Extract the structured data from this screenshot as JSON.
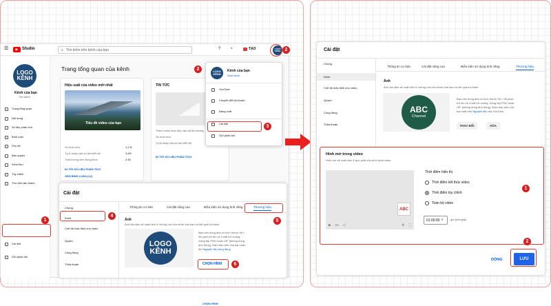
{
  "left": {
    "app": {
      "logo": "Studio",
      "search_placeholder": "Tìm kiếm trên kênh của bạn",
      "create_label": "TẠO"
    },
    "channel": {
      "logo_line1": "LOGO",
      "logo_line2": "KÊNH",
      "name": "Kênh của bạn",
      "handle": "Tên kênh"
    },
    "sidebar": [
      {
        "label": "Trang tổng quan",
        "icon": "dashboard-icon"
      },
      {
        "label": "Nội dung",
        "icon": "content-icon"
      },
      {
        "label": "Số liệu phân tích",
        "icon": "analytics-icon"
      },
      {
        "label": "Bình luận",
        "icon": "comments-icon"
      },
      {
        "label": "Phụ đề",
        "icon": "subtitles-icon"
      },
      {
        "label": "Bản quyền",
        "icon": "copyright-icon"
      },
      {
        "label": "Kiếm tiền",
        "icon": "monetization-icon"
      },
      {
        "label": "Tùy chỉnh",
        "icon": "customization-icon"
      },
      {
        "label": "Thư viện âm thanh",
        "icon": "audio-library-icon"
      }
    ],
    "sidebar_bottom": [
      {
        "label": "Cài đặt",
        "icon": "gear-icon"
      },
      {
        "label": "Gửi phản hồi",
        "icon": "feedback-icon"
      }
    ],
    "dashboard": {
      "title": "Trang tổng quan của kênh",
      "perf_title": "Hiệu suất của video mới nhất",
      "thumb_caption": "Tiêu đề video của bạn",
      "stats": [
        {
          "label": "Số lượt xem",
          "value": "1,2 N"
        },
        {
          "label": "Tỷ lệ nhấp của số lần hiển thị",
          "value": "3,6%"
        },
        {
          "label": "Thời lượng xem trung bình",
          "value": "2:45"
        }
      ],
      "analytics_link": "ĐI TỚI SỐ LIỆU PHÂN TÍCH",
      "comments_link": "XEM BÌNH LUẬN (12)",
      "news_title": "TIN TỨC",
      "news_lines": [
        "Thêm chiến lược tiếp cận đa thị trường",
        "Số lượt xem",
        "Tỷ lệ nhấp của số lần hiển thị"
      ],
      "news_link": "ĐI TỚI SỐ LIỆU PHÂN TÍCH"
    },
    "account_menu": {
      "name": "Kênh của bạn",
      "link": "Xem kênh",
      "items": [
        {
          "label": "YouTube",
          "icon": "youtube-icon"
        },
        {
          "label": "Chuyển đổi tài khoản",
          "icon": "switch-account-icon"
        },
        {
          "label": "Đăng xuất",
          "icon": "logout-icon"
        },
        {
          "label": "Cài đặt",
          "icon": "gear-icon"
        },
        {
          "label": "Gửi phản hồi",
          "icon": "feedback-icon"
        }
      ]
    },
    "settings": {
      "title": "Cài đặt",
      "nav": [
        "Chung",
        "Kênh",
        "Chế độ mặc định cho video",
        "Quyền",
        "Cộng đồng",
        "Thỏa thuận"
      ],
      "tabs": [
        "Thông tin cơ bản",
        "Cài đặt nâng cao",
        "Điều kiện sử dụng tính năng",
        "Thương hiệu"
      ],
      "image_title": "Ảnh",
      "image_desc": "Ảnh đại diện sẽ xuất hiện ở những nơi như kênh của bạn và kết quả tìm kiếm",
      "image_hint": "Bạn nên dùng ảnh có kích thước 98 × 98 pixel trở lên và 4 MB trở xuống. Dùng tệp PNG hoặc GIF (không dùng ảnh động). Đảm bảo ảnh của bạn tuân thủ",
      "guidelines_link": "Nguyên tắc cộng đồng",
      "upload_label": "CHỌN HÌNH"
    },
    "steps": [
      "1",
      "2",
      "3",
      "4",
      "5",
      "6"
    ]
  },
  "right": {
    "title": "Cài đặt",
    "nav": [
      "Chung",
      "Kênh",
      "Chế độ mặc định cho video",
      "Quyền",
      "Cộng đồng",
      "Thỏa thuận"
    ],
    "tabs": [
      "Thông tin cơ bản",
      "Cài đặt nâng cao",
      "Điều kiện sử dụng tính năng",
      "Thương hiệu"
    ],
    "image_title": "Ảnh",
    "image_desc": "Ảnh đại diện sẽ xuất hiện ở những nơi như kênh của bạn và kết quả tìm kiếm",
    "image_hint": "Bạn nên dùng ảnh có kích thước 98 × 98 pixel trở lên và 4 MB trở xuống. Dùng tệp PNG hoặc GIF (không dùng ảnh động). Đảm bảo ảnh của bạn tuân thủ",
    "guidelines_link": "Nguyên tắc",
    "guidelines_tail": "của YouTube",
    "abc_line1": "ABC",
    "abc_line2": "Channel",
    "change_label": "THAY ĐỔI",
    "remove_label": "XÓA",
    "watermark": {
      "title": "Hình mờ trong video",
      "desc": "Hình mờ sẽ xuất hiện ở góc phải của trình phát video",
      "time_title": "Thời điểm hiển thị",
      "options": [
        "Thời điểm kết thúc video",
        "Thời điểm tùy chỉnh",
        "Toàn bộ video"
      ],
      "selected_index": 1,
      "time_value": "01:00:00",
      "time_unit": "giờ:phút:giây",
      "preview_logo": "ABC"
    },
    "done_label": "DÓNG",
    "save_label": "LƯU",
    "steps": [
      "1",
      "2"
    ]
  },
  "colors": {
    "accent_red": "#e53935",
    "youtube_blue": "#065fd4",
    "logo_blue": "#1e4b7a",
    "abc_green": "#1f5c48"
  }
}
